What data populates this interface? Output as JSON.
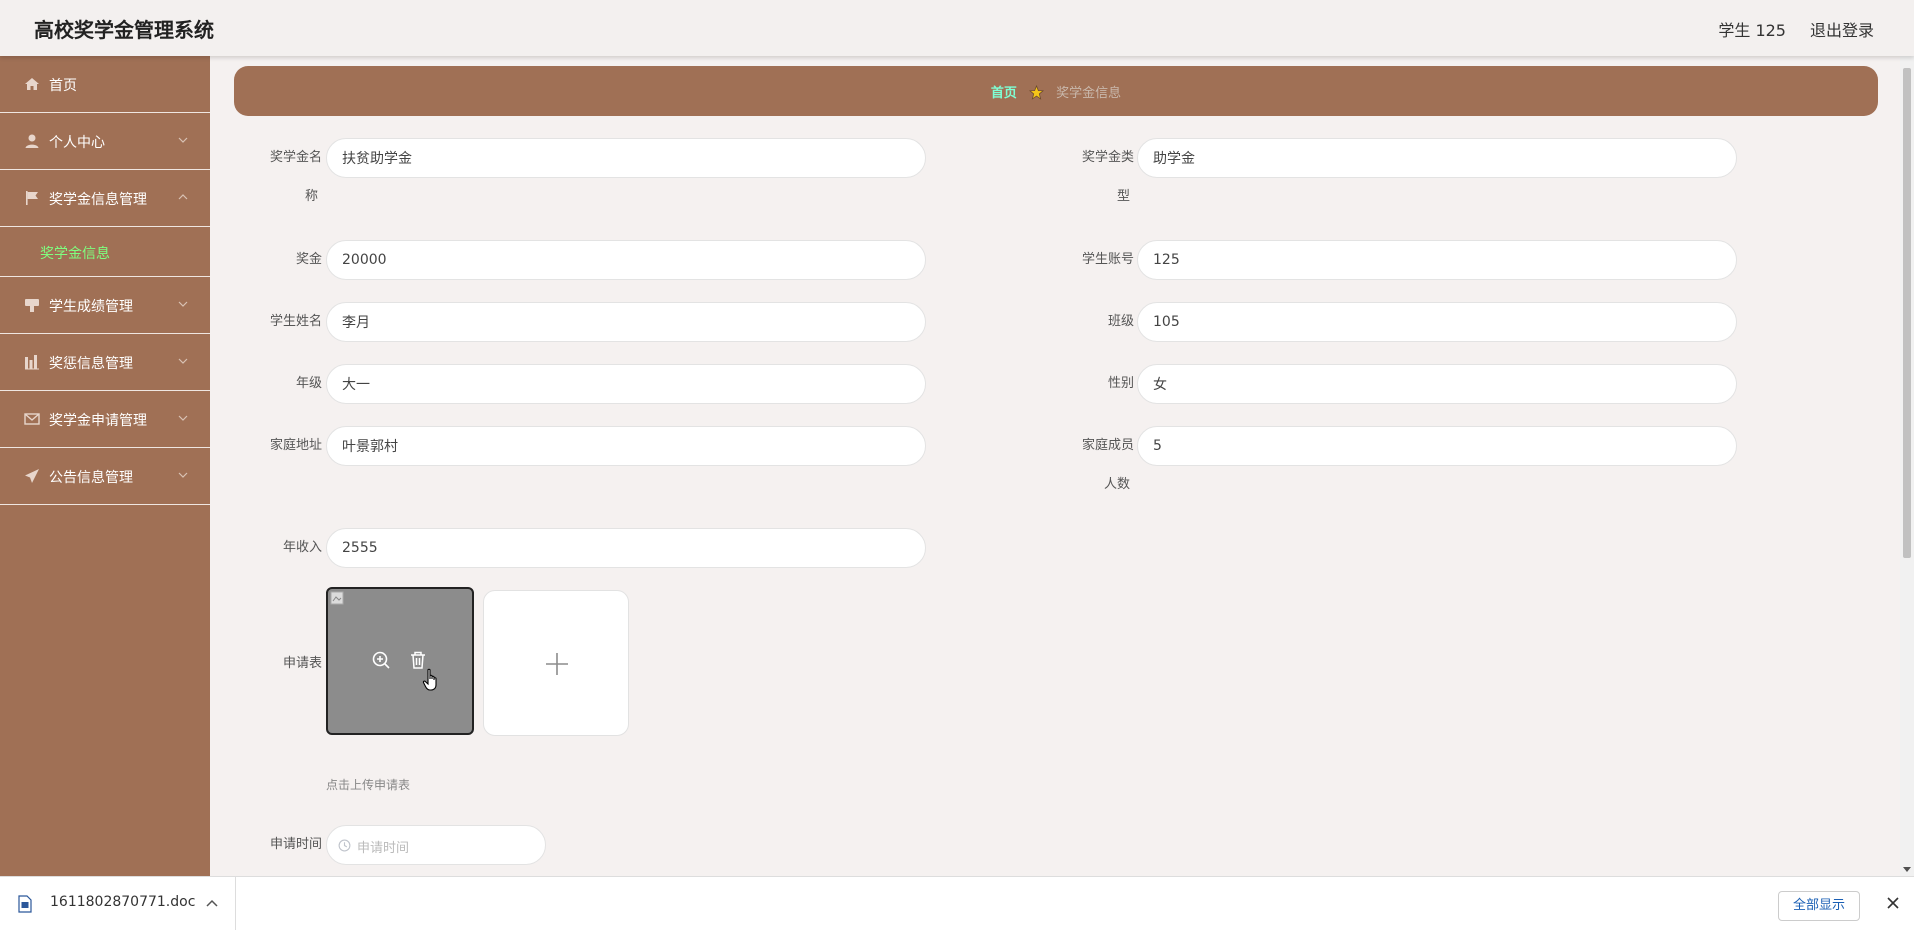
{
  "app": {
    "title": "高校奖学金管理系统",
    "user_label": "学生 125",
    "logout_label": "退出登录"
  },
  "sidebar": {
    "items": [
      {
        "label": "首页",
        "icon": "home-icon"
      },
      {
        "label": "个人中心",
        "icon": "user-icon"
      },
      {
        "label": "奖学金信息管理",
        "icon": "flag-icon",
        "expanded": true,
        "children": [
          "奖学金信息"
        ]
      },
      {
        "label": "学生成绩管理",
        "icon": "tablet-icon"
      },
      {
        "label": "奖惩信息管理",
        "icon": "chart-icon"
      },
      {
        "label": "奖学金申请管理",
        "icon": "mail-icon"
      },
      {
        "label": "公告信息管理",
        "icon": "send-icon"
      }
    ],
    "active_submenu": "奖学金信息"
  },
  "breadcrumb": {
    "home": "首页",
    "current": "奖学金信息"
  },
  "form": {
    "scholarship_name": {
      "label": "奖学金名称",
      "label_line1": "奖学金名",
      "label_line2": "称",
      "value": "扶贫助学金"
    },
    "scholarship_type": {
      "label": "奖学金类型",
      "label_line1": "奖学金类",
      "label_line2": "型",
      "value": "助学金"
    },
    "bonus": {
      "label": "奖金",
      "value": "20000"
    },
    "student_account": {
      "label": "学生账号",
      "value": "125"
    },
    "student_name": {
      "label": "学生姓名",
      "value": "李月"
    },
    "class": {
      "label": "班级",
      "value": "105"
    },
    "grade": {
      "label": "年级",
      "value": "大一"
    },
    "gender": {
      "label": "性别",
      "value": "女"
    },
    "address": {
      "label": "家庭地址",
      "value": "叶景郭村"
    },
    "family_members": {
      "label": "家庭成员人数",
      "label_line1": "家庭成员",
      "label_line2": "人数",
      "value": "5"
    },
    "annual_income": {
      "label": "年收入",
      "value": "2555"
    },
    "application_form": {
      "label": "申请表",
      "upload_tip": "点击上传申请表"
    },
    "apply_time": {
      "label": "申请时间",
      "placeholder": "申请时间"
    }
  },
  "download_bar": {
    "file_name": "1611802870771.doc",
    "show_all_label": "全部显示"
  },
  "colors": {
    "sidebar": "#a07055",
    "breadcrumb_bg": "#a07055",
    "crumb_home": "#7fffd4",
    "active_submenu": "#7fff7f",
    "page_bg": "#f5f1f0"
  }
}
